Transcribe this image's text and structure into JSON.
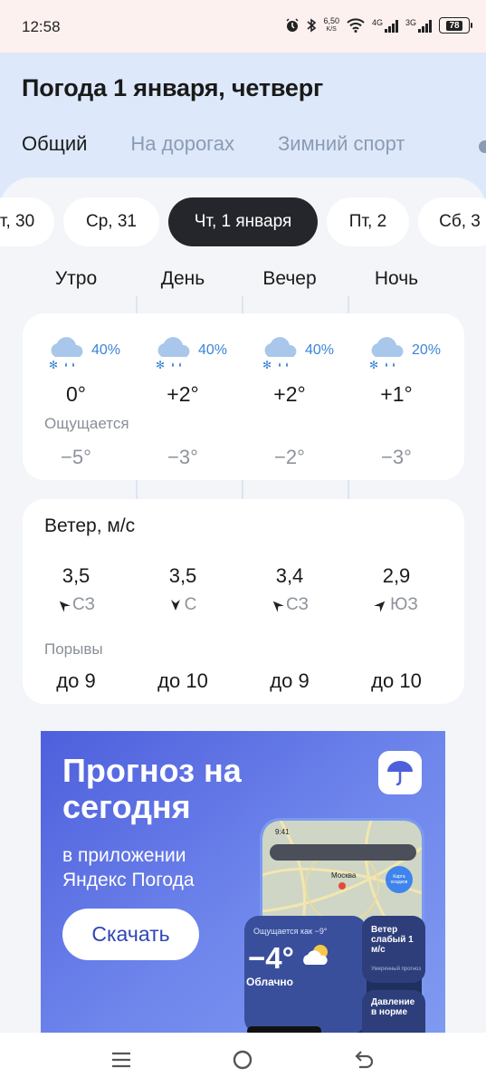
{
  "status_bar": {
    "time": "12:58",
    "net_speed_value": "6,50",
    "net_speed_unit": "K/S",
    "sim1_label": "4G",
    "sim2_label": "3G",
    "battery": "78"
  },
  "header": {
    "title": "Погода 1 января, четверг",
    "tabs": [
      {
        "label": "Общий",
        "active": true
      },
      {
        "label": "На дорогах",
        "active": false
      },
      {
        "label": "Зимний спорт",
        "active": false
      }
    ]
  },
  "day_chips": [
    {
      "label": "т, 30",
      "active": false
    },
    {
      "label": "Ср, 31",
      "active": false
    },
    {
      "label": "Чт, 1 января",
      "active": true
    },
    {
      "label": "Пт, 2",
      "active": false
    },
    {
      "label": "Сб, 3",
      "active": false
    }
  ],
  "periods": [
    "Утро",
    "День",
    "Вечер",
    "Ночь"
  ],
  "temperature": {
    "icon": "cloud-snow-rain-icon",
    "precip": [
      "40%",
      "40%",
      "40%",
      "20%"
    ],
    "temps": [
      "0°",
      "+2°",
      "+2°",
      "+1°"
    ],
    "feels_label": "Ощущается",
    "feels": [
      "−5°",
      "−3°",
      "−2°",
      "−3°"
    ]
  },
  "wind": {
    "title": "Ветер, м/с",
    "speeds": [
      "3,5",
      "3,5",
      "3,4",
      "2,9"
    ],
    "directions": [
      "СЗ",
      "С",
      "СЗ",
      "ЮЗ"
    ],
    "gusts_label": "Порывы",
    "gusts": [
      "до 9",
      "до 10",
      "до 9",
      "до 10"
    ]
  },
  "ad": {
    "title": "Прогноз на сегодня",
    "subtitle": "в приложении Яндекс Погода",
    "button": "Скачать",
    "phone": {
      "time": "9:41",
      "city": "Москва",
      "map_button": "Карта осадков",
      "feels": "Ощущается как −9°",
      "temp": "−4°",
      "desc": "Облачно",
      "wind_card": "Ветер слабый 1 м/с",
      "wind_card_sub": "Умеренный прогноз",
      "pressure_card": "Давление в норме"
    },
    "accent_color": "#5b6ee3"
  },
  "colors": {
    "header_bg": "#dde9fb",
    "sheet_bg": "#f3f5f8",
    "active_chip": "#24262c",
    "precip": "#3c84d8",
    "muted": "#8e939c"
  }
}
